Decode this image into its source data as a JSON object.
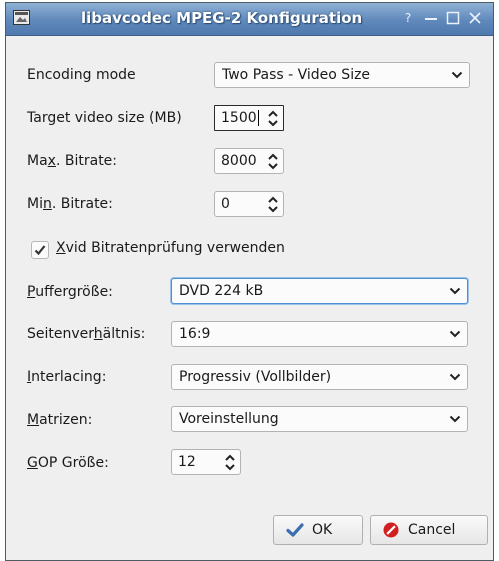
{
  "window": {
    "title": "libavcodec MPEG-2 Konfiguration",
    "help_symbol": "?"
  },
  "encoding_mode": {
    "label": "Encoding mode",
    "value": "Two Pass - Video Size"
  },
  "target_size": {
    "label": "Target video size (MB)",
    "value": "1500"
  },
  "max_bitrate": {
    "label_pre": "Ma",
    "label_ul": "x",
    "label_post": ". Bitrate:",
    "value": "8000"
  },
  "min_bitrate": {
    "label_pre": "Mi",
    "label_ul": "n",
    "label_post": ". Bitrate:",
    "value": "0"
  },
  "xvid_check": {
    "label_ul": "X",
    "label_post": "vid Bitratenprüfung verwenden",
    "checked": true
  },
  "buffer": {
    "label_ul": "P",
    "label_post": "uffergröße:",
    "value": "DVD 224 kB"
  },
  "aspect": {
    "label_pre": "Seitenver",
    "label_ul": "h",
    "label_post": "ältnis:",
    "value": "16:9"
  },
  "interlacing": {
    "label_ul": "I",
    "label_post": "nterlacing:",
    "value": "Progressiv (Vollbilder)"
  },
  "matrices": {
    "label_ul": "M",
    "label_post": "atrizen:",
    "value": "Voreinstellung"
  },
  "gop": {
    "label_ul": "G",
    "label_post": "OP Größe:",
    "value": "12"
  },
  "buttons": {
    "ok": "OK",
    "cancel": "Cancel"
  },
  "colors": {
    "titlebar": "#5f88bb",
    "focus": "#4f8fd3",
    "dialog_bg": "#efefef",
    "ok_icon": "#3d6fb0",
    "cancel_icon": "#d22020"
  }
}
